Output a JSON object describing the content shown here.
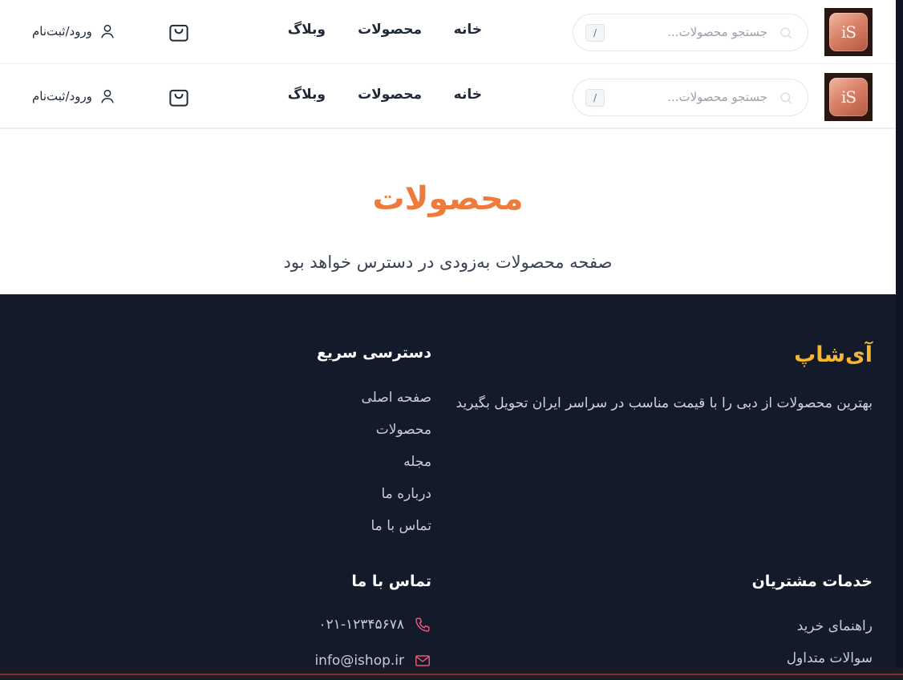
{
  "header": {
    "logo_text": "iS",
    "search_placeholder": "جستجو محصولات...",
    "search_shortcut": "/",
    "nav": [
      "خانه",
      "محصولات",
      "وبلاگ"
    ],
    "login_label": "ورود/ثبت‌نام"
  },
  "main": {
    "title": "محصولات",
    "subtitle": "صفحه محصولات به‌زودی در دسترس خواهد بود"
  },
  "footer": {
    "brand": "آی‌شاپ",
    "description": "بهترین محصولات از دبی را با قیمت مناسب در سراسر ایران تحویل بگیرید",
    "quick_access": {
      "title": "دسترسی سریع",
      "items": [
        "صفحه اصلی",
        "محصولات",
        "مجله",
        "درباره ما",
        "تماس با ما"
      ]
    },
    "customer_service": {
      "title": "خدمات مشتریان",
      "items": [
        "راهنمای خرید",
        "سوالات متداول"
      ]
    },
    "contact": {
      "title": "تماس با ما",
      "phone": "۰۲۱-۱۲۳۴۵۶۷۸",
      "email": "info@ishop.ir"
    }
  },
  "colors": {
    "accent": "#ee7a3b",
    "brand_yellow": "#f6b62e",
    "footer_bg": "#131a2a",
    "contact_icon": "#e8587a"
  },
  "icons": [
    "logo",
    "search-icon",
    "cart-icon",
    "user-icon",
    "phone-icon",
    "mail-icon"
  ]
}
